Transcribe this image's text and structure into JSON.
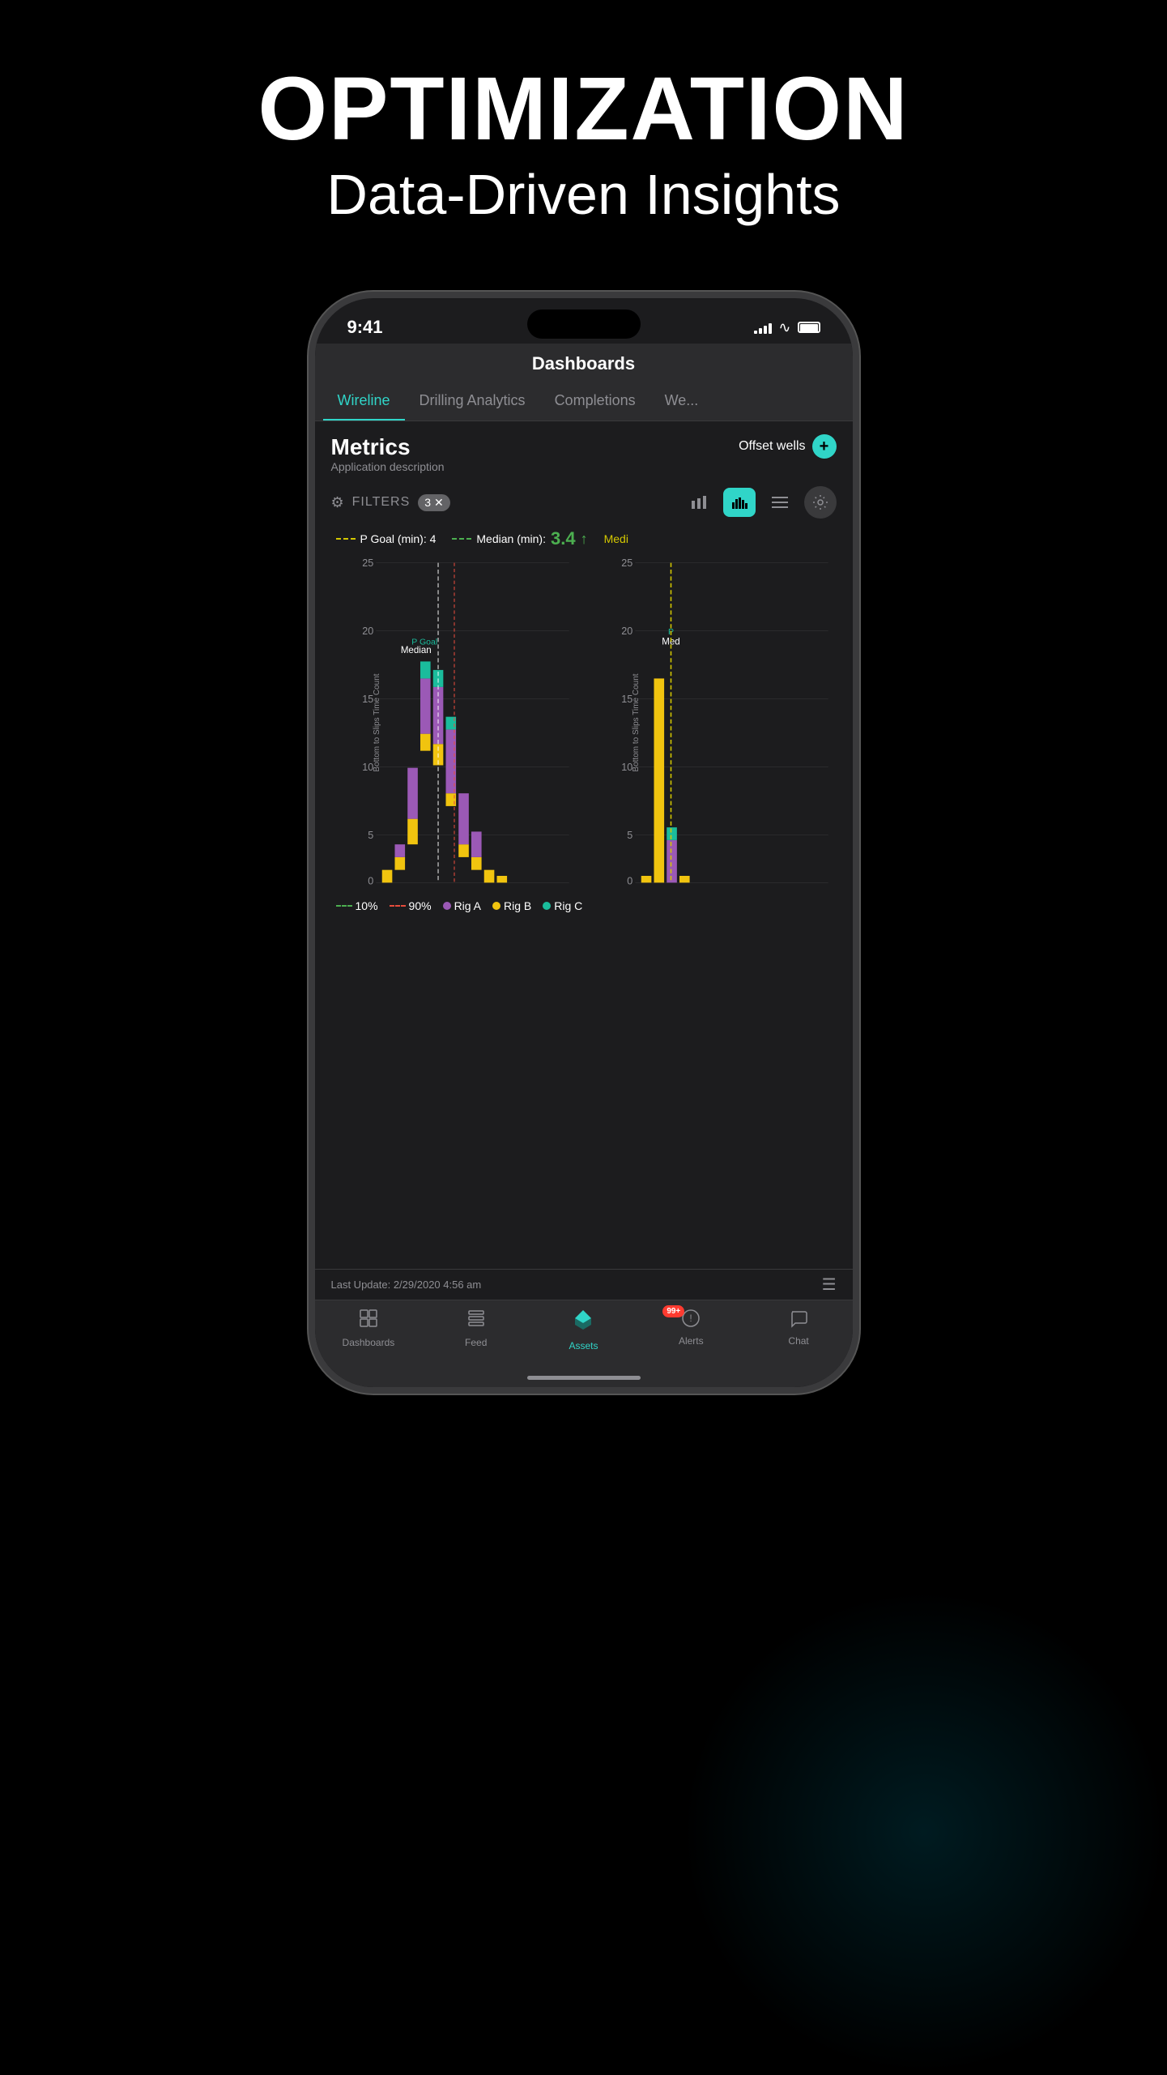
{
  "page": {
    "heading": "OPTIMIZATION",
    "subheading": "Data-Driven Insights"
  },
  "status_bar": {
    "time": "9:41",
    "signal_bars": [
      3,
      6,
      9,
      12,
      15
    ],
    "battery": "full"
  },
  "app": {
    "title": "Dashboards",
    "tabs": [
      {
        "label": "Wireline",
        "active": true
      },
      {
        "label": "Drilling Analytics",
        "active": false
      },
      {
        "label": "Completions",
        "active": false
      },
      {
        "label": "We...",
        "active": false
      }
    ]
  },
  "metrics": {
    "title": "Metrics",
    "subtitle": "Application description",
    "offset_wells_label": "Offset wells",
    "filter_count": "3"
  },
  "chart": {
    "p_goal_label": "P Goal (min):",
    "p_goal_value": "4",
    "median_label": "Median (min):",
    "median_value": "3.4",
    "y_title": "Bottom to Slips Time Count",
    "y_labels": [
      "25",
      "20",
      "15",
      "10",
      "5",
      "0"
    ],
    "median_annotation": "Median",
    "p_goal_annotation": "P Goal"
  },
  "legend": {
    "pct_10": "10%",
    "pct_90": "90%",
    "rig_a": "Rig A",
    "rig_b": "Rig B",
    "rig_c": "Rig C",
    "color_a": "#9b59b6",
    "color_b": "#f1c40f",
    "color_c": "#1abc9c"
  },
  "bottom_bar": {
    "last_update": "Last Update: 2/29/2020 4:56 am"
  },
  "nav": {
    "items": [
      {
        "label": "Dashboards",
        "icon": "⊞",
        "active": false
      },
      {
        "label": "Feed",
        "icon": "📋",
        "active": false
      },
      {
        "label": "Assets",
        "icon": "◈",
        "active": true
      },
      {
        "label": "Alerts",
        "icon": "🔔",
        "active": false,
        "badge": "99+"
      },
      {
        "label": "Chat",
        "icon": "💬",
        "active": false
      }
    ]
  }
}
